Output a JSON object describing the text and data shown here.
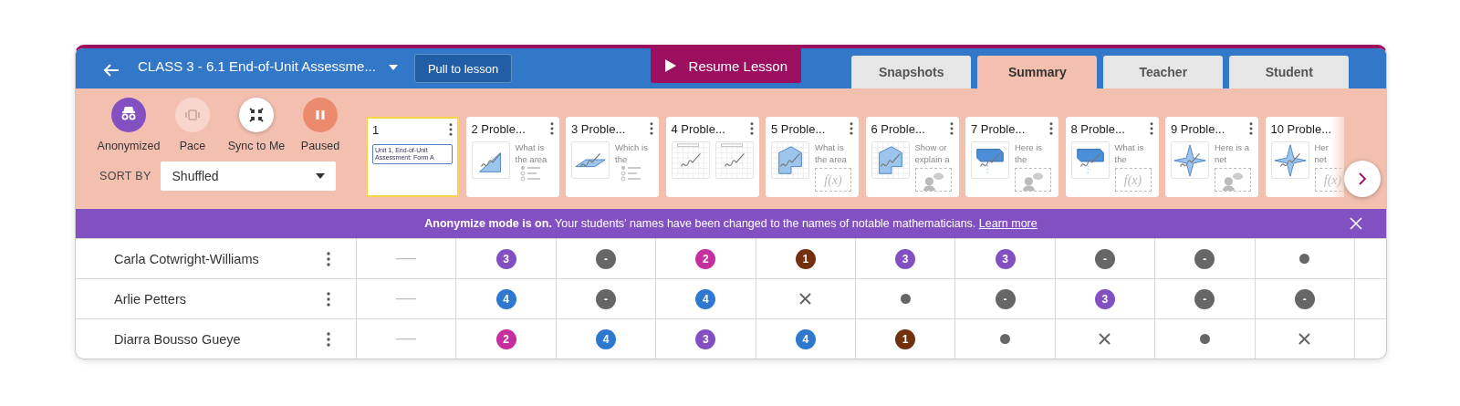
{
  "header": {
    "title": "CLASS 3 - 6.1 End-of-Unit Assessme...",
    "pull_button": "Pull to lesson",
    "resume_button": "Resume Lesson"
  },
  "tabs": [
    {
      "label": "Snapshots",
      "selected": false
    },
    {
      "label": "Summary",
      "selected": true
    },
    {
      "label": "Teacher",
      "selected": false
    },
    {
      "label": "Student",
      "selected": false
    }
  ],
  "controls": [
    {
      "label": "Anonymized",
      "kind": "anonymize",
      "on": true
    },
    {
      "label": "Pace",
      "kind": "pace",
      "on": false
    },
    {
      "label": "Sync to Me",
      "kind": "sync",
      "on": false
    },
    {
      "label": "Paused",
      "kind": "pause",
      "on": true
    }
  ],
  "sort": {
    "label": "SORT BY",
    "value": "Shuffled"
  },
  "slides": [
    {
      "number": "1",
      "selected": true,
      "kind": "title",
      "doc_text": "Unit 1, End-of-Unit Assessment: Form A"
    },
    {
      "number": "2",
      "title": "Proble...",
      "selected": false,
      "kind": "graph",
      "prompt": [
        "What is",
        "the area"
      ],
      "response": {
        "kind": "choice"
      }
    },
    {
      "number": "3",
      "title": "Proble...",
      "selected": false,
      "kind": "plane",
      "prompt": [
        "Which is",
        "the"
      ],
      "response": {
        "kind": "choice"
      }
    },
    {
      "number": "4",
      "title": "Proble...",
      "selected": false,
      "kind": "grids"
    },
    {
      "number": "5",
      "title": "Proble...",
      "selected": false,
      "kind": "polygon",
      "prompt": [
        "What is",
        "the area"
      ],
      "response": {
        "kind": "math",
        "label": "f(x)"
      }
    },
    {
      "number": "6",
      "title": "Proble...",
      "selected": false,
      "kind": "polygon",
      "prompt": [
        "Show or",
        "explain a"
      ],
      "response": {
        "kind": "discuss"
      }
    },
    {
      "number": "7",
      "title": "Proble...",
      "selected": false,
      "kind": "prism",
      "prompt": [
        "Here is",
        "the"
      ],
      "response": {
        "kind": "discuss"
      }
    },
    {
      "number": "8",
      "title": "Proble...",
      "selected": false,
      "kind": "prism",
      "prompt": [
        "What is",
        "the"
      ],
      "response": {
        "kind": "math",
        "label": "f(x)"
      }
    },
    {
      "number": "9",
      "title": "Proble...",
      "selected": false,
      "kind": "net",
      "prompt": [
        "Here is a",
        "net"
      ],
      "response": {
        "kind": "discuss"
      }
    },
    {
      "number": "10",
      "title": "Proble...",
      "selected": false,
      "kind": "net",
      "prompt": [
        "Her",
        "net"
      ],
      "response": {
        "kind": "math",
        "label": "f(x)"
      }
    }
  ],
  "banner": {
    "text": "**Anonymize mode is on.** Your students’ names have been changed to the names of notable mathematicians.",
    "link": "Learn more"
  },
  "students": [
    {
      "name": "Carla Cotwright-Williams",
      "cells": [
        {
          "kind": "none"
        },
        {
          "kind": "score",
          "text": "3",
          "color": "#8350c2"
        },
        {
          "kind": "skipped",
          "text": "-"
        },
        {
          "kind": "score",
          "text": "2",
          "color": "#c72e9e"
        },
        {
          "kind": "score",
          "text": "1",
          "color": "#73300f"
        },
        {
          "kind": "score",
          "text": "3",
          "color": "#8350c2"
        },
        {
          "kind": "score",
          "text": "3",
          "color": "#8350c2"
        },
        {
          "kind": "skipped",
          "text": "-"
        },
        {
          "kind": "skipped",
          "text": "-"
        },
        {
          "kind": "dot"
        }
      ]
    },
    {
      "name": "Arlie Petters",
      "cells": [
        {
          "kind": "none"
        },
        {
          "kind": "score",
          "text": "4",
          "color": "#2e78cf"
        },
        {
          "kind": "skipped",
          "text": "-"
        },
        {
          "kind": "score",
          "text": "4",
          "color": "#2e78cf"
        },
        {
          "kind": "cross"
        },
        {
          "kind": "dot"
        },
        {
          "kind": "skipped",
          "text": "-"
        },
        {
          "kind": "score",
          "text": "3",
          "color": "#8350c2"
        },
        {
          "kind": "skipped",
          "text": "-"
        },
        {
          "kind": "skipped",
          "text": "-"
        }
      ]
    },
    {
      "name": "Diarra Bousso Gueye",
      "cells": [
        {
          "kind": "none"
        },
        {
          "kind": "score",
          "text": "2",
          "color": "#c72e9e"
        },
        {
          "kind": "score",
          "text": "4",
          "color": "#2e78cf"
        },
        {
          "kind": "score",
          "text": "3",
          "color": "#8350c2"
        },
        {
          "kind": "score",
          "text": "4",
          "color": "#2e78cf"
        },
        {
          "kind": "score",
          "text": "1",
          "color": "#73300f"
        },
        {
          "kind": "dot"
        },
        {
          "kind": "cross"
        },
        {
          "kind": "dot"
        },
        {
          "kind": "cross"
        }
      ]
    }
  ]
}
